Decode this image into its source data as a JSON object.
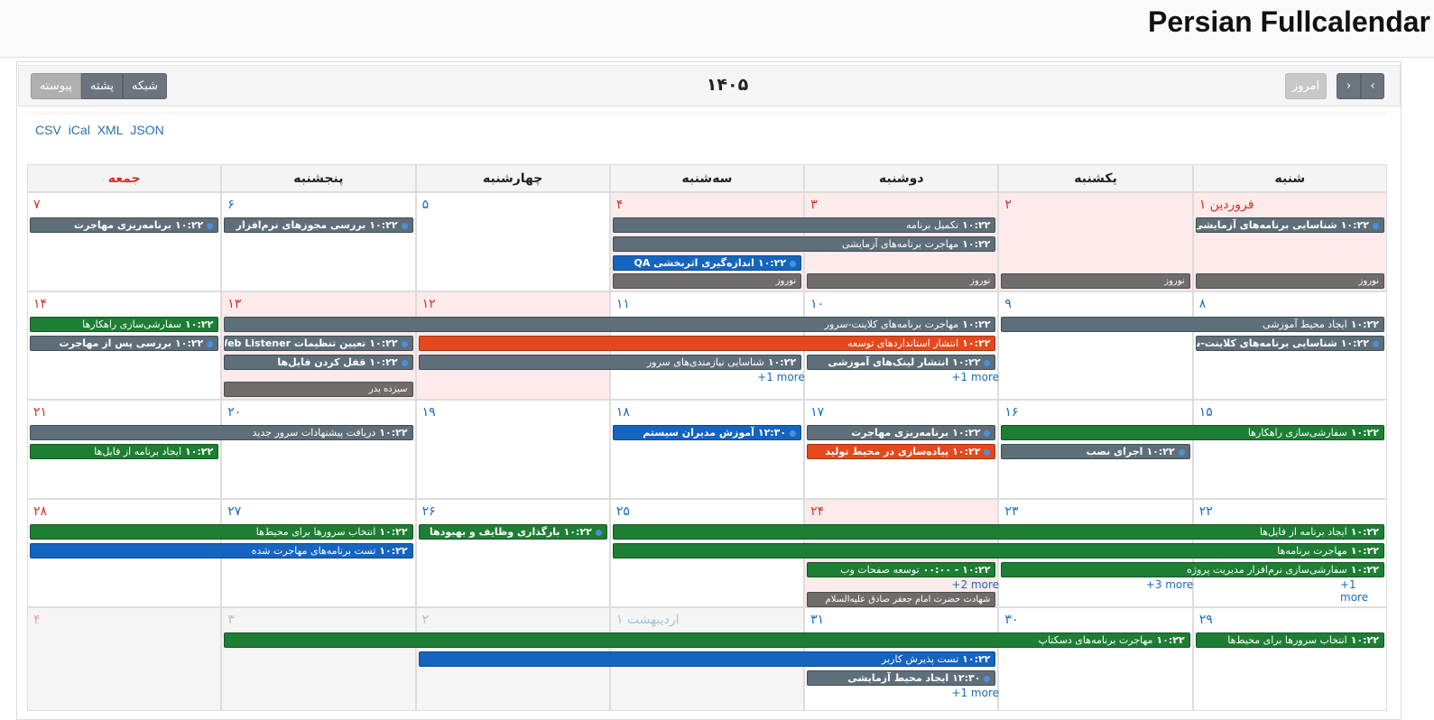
{
  "brand": "Persian Fullcalendar",
  "toolbar": {
    "prev": "‹",
    "next": "›",
    "today": "امروز",
    "title": "۱۴۰۵",
    "views": [
      "شبکه",
      "پشته",
      "پیوسته"
    ]
  },
  "exports": [
    "CSV",
    "iCal",
    "XML",
    "JSON"
  ],
  "weekdays": [
    "شنبه",
    "یکشنبه",
    "دوشنبه",
    "سه‌شنبه",
    "چهارشنبه",
    "پنجشنبه",
    "جمعه"
  ],
  "colors": {
    "gray": "#5f6f7a",
    "green": "#1e7e34",
    "blue": "#1565c0",
    "red": "#e4491c",
    "holiday": "#706c6c",
    "dayRed": "#d0322a",
    "dayBlue": "#1b6bb8"
  },
  "weeks": [
    {
      "days": [
        {
          "label": "فروردین ۱",
          "red": true,
          "hl": true
        },
        {
          "label": "۲",
          "red": true,
          "hl": true
        },
        {
          "label": "۳",
          "red": true,
          "hl": true
        },
        {
          "label": "۴",
          "red": true,
          "hl": true
        },
        {
          "label": "۵"
        },
        {
          "label": "۶"
        },
        {
          "label": "۷",
          "red": true
        }
      ],
      "events": [
        {
          "s": 0,
          "e": 0,
          "r": 0,
          "time": "۱۰:۲۲",
          "title": "شناسایی برنامه‌های آزمایشی",
          "color": "gray",
          "dot": true,
          "bold": true
        },
        {
          "s": 2,
          "e": 3,
          "r": 0,
          "time": "۱۰:۲۲",
          "title": "تکمیل برنامه",
          "color": "gray"
        },
        {
          "s": 2,
          "e": 3,
          "r": 1,
          "time": "۱۰:۲۲",
          "title": "مهاجرت برنامه‌های آزمایشی",
          "color": "gray"
        },
        {
          "s": 3,
          "e": 3,
          "r": 2,
          "time": "۱۰:۲۲",
          "title": "اندازه‌گیری اثربخشی QA",
          "color": "blue",
          "dot": true,
          "bold": true
        },
        {
          "s": 5,
          "e": 5,
          "r": 0,
          "time": "۱۰:۲۲",
          "title": "بررسی مجوزهای نرم‌افزار",
          "color": "gray",
          "dot": true,
          "bold": true
        },
        {
          "s": 6,
          "e": 6,
          "r": 0,
          "time": "۱۰:۲۲",
          "title": "برنامه‌ریزی مهاجرت",
          "color": "gray",
          "dot": true,
          "bold": true
        },
        {
          "s": 0,
          "e": 0,
          "r": 3,
          "time": "",
          "title": "نوروز",
          "color": "holi"
        },
        {
          "s": 1,
          "e": 1,
          "r": 3,
          "time": "",
          "title": "نوروز",
          "color": "holi"
        },
        {
          "s": 2,
          "e": 2,
          "r": 3,
          "time": "",
          "title": "نوروز",
          "color": "holi"
        },
        {
          "s": 3,
          "e": 3,
          "r": 3,
          "time": "",
          "title": "نوروز",
          "color": "holi"
        }
      ],
      "more": []
    },
    {
      "days": [
        {
          "label": "۸"
        },
        {
          "label": "۹"
        },
        {
          "label": "۱۰"
        },
        {
          "label": "۱۱"
        },
        {
          "label": "۱۲",
          "red": true,
          "hl": true
        },
        {
          "label": "۱۳",
          "red": true,
          "hl": true
        },
        {
          "label": "۱۴",
          "red": true
        }
      ],
      "events": [
        {
          "s": 0,
          "e": 1,
          "r": 0,
          "time": "۱۰:۲۲",
          "title": "ایجاد محیط آموزشی",
          "color": "gray"
        },
        {
          "s": 2,
          "e": 5,
          "r": 0,
          "time": "۱۰:۲۲",
          "title": "مهاجرت برنامه‌های کلاینت-سرور",
          "color": "gray"
        },
        {
          "s": 6,
          "e": 6,
          "r": 0,
          "time": "۱۰:۲۲",
          "title": "سفارشی‌سازی راهکارها",
          "color": "green"
        },
        {
          "s": 0,
          "e": 0,
          "r": 1,
          "time": "۱۰:۲۲",
          "title": "شناسایی برنامه‌های کلاینت-سرور",
          "color": "gray",
          "dot": true,
          "bold": true
        },
        {
          "s": 2,
          "e": 4,
          "r": 1,
          "time": "۱۰:۲۲",
          "title": "انتشار استانداردهای توسعه",
          "color": "red"
        },
        {
          "s": 5,
          "e": 5,
          "r": 1,
          "time": "۱۰:۲۲",
          "title": "تعیین تنظیمات Web Listener",
          "color": "gray",
          "dot": true,
          "bold": true
        },
        {
          "s": 6,
          "e": 6,
          "r": 1,
          "time": "۱۰:۲۲",
          "title": "بررسی پس از مهاجرت",
          "color": "gray",
          "dot": true,
          "bold": true
        },
        {
          "s": 2,
          "e": 2,
          "r": 2,
          "time": "۱۰:۲۲",
          "title": "انتشار لینک‌های آموزشی",
          "color": "gray",
          "dot": true,
          "bold": true
        },
        {
          "s": 3,
          "e": 4,
          "r": 2,
          "time": "۱۰:۲۲",
          "title": "شناسایی نیازمندی‌های سرور",
          "color": "gray"
        },
        {
          "s": 5,
          "e": 5,
          "r": 2,
          "time": "۱۰:۲۲",
          "title": "قفل کردن فایل‌ها",
          "color": "gray",
          "dot": true,
          "bold": true
        },
        {
          "s": 5,
          "e": 5,
          "r": 3,
          "time": "",
          "title": "سیزده بدر",
          "color": "holi"
        }
      ],
      "more": [
        {
          "col": 2,
          "text": "+1 more"
        },
        {
          "col": 3,
          "text": "+1 more"
        }
      ]
    },
    {
      "days": [
        {
          "label": "۱۵"
        },
        {
          "label": "۱۶"
        },
        {
          "label": "۱۷"
        },
        {
          "label": "۱۸"
        },
        {
          "label": "۱۹"
        },
        {
          "label": "۲۰"
        },
        {
          "label": "۲۱",
          "red": true
        }
      ],
      "events": [
        {
          "s": 0,
          "e": 1,
          "r": 0,
          "time": "۱۰:۲۲",
          "title": "سفارشی‌سازی راهکارها",
          "color": "green"
        },
        {
          "s": 2,
          "e": 2,
          "r": 0,
          "time": "۱۰:۲۲",
          "title": "برنامه‌ریزی مهاجرت",
          "color": "gray",
          "dot": true,
          "bold": true
        },
        {
          "s": 3,
          "e": 3,
          "r": 0,
          "time": "۱۲:۳۰",
          "title": "آموزش مدیران سیستم",
          "color": "blue",
          "dot": true,
          "bold": true
        },
        {
          "s": 5,
          "e": 6,
          "r": 0,
          "time": "۱۰:۲۲",
          "title": "دریافت پیشنهادات سرور جدید",
          "color": "gray"
        },
        {
          "s": 1,
          "e": 1,
          "r": 1,
          "time": "۱۰:۲۲",
          "title": "اجرای نصب",
          "color": "gray",
          "dot": true,
          "bold": true
        },
        {
          "s": 2,
          "e": 2,
          "r": 1,
          "time": "۱۰:۲۲",
          "title": "پیاده‌سازی در محیط تولید",
          "color": "red",
          "dot": true,
          "bold": true
        },
        {
          "s": 6,
          "e": 6,
          "r": 1,
          "time": "۱۰:۲۲",
          "title": "ایجاد برنامه از فایل‌ها",
          "color": "green"
        }
      ],
      "more": []
    },
    {
      "days": [
        {
          "label": "۲۲"
        },
        {
          "label": "۲۳"
        },
        {
          "label": "۲۴",
          "red": true,
          "hl": true
        },
        {
          "label": "۲۵"
        },
        {
          "label": "۲۶"
        },
        {
          "label": "۲۷"
        },
        {
          "label": "۲۸",
          "red": true
        }
      ],
      "events": [
        {
          "s": 0,
          "e": 3,
          "r": 0,
          "time": "۱۰:۲۲",
          "title": "ایجاد برنامه از فایل‌ها",
          "color": "green"
        },
        {
          "s": 4,
          "e": 4,
          "r": 0,
          "time": "۱۰:۲۲",
          "title": "بارگذاری وظایف و بهبودها",
          "color": "green",
          "dot": true,
          "bold": true
        },
        {
          "s": 5,
          "e": 6,
          "r": 0,
          "time": "۱۰:۲۲",
          "title": "انتخاب سرورها برای محیط‌ها",
          "color": "green"
        },
        {
          "s": 0,
          "e": 3,
          "r": 1,
          "time": "۱۰:۲۲",
          "title": "مهاجرت برنامه‌ها",
          "color": "green"
        },
        {
          "s": 5,
          "e": 6,
          "r": 1,
          "time": "۱۰:۲۲",
          "title": "تست برنامه‌های مهاجرت شده",
          "color": "blue"
        },
        {
          "s": 0,
          "e": 1,
          "r": 2,
          "time": "۱۰:۲۲",
          "title": "سفارشی‌سازی نرم‌افزار مدیریت پروژه",
          "color": "green"
        },
        {
          "s": 2,
          "e": 2,
          "r": 2,
          "time": "۱۰:۲۲ - ۰۰:۰۰",
          "title": "توسعه صفحات وب",
          "color": "green"
        },
        {
          "s": 2,
          "e": 2,
          "r": 4,
          "time": "",
          "title": "شهادت حضرت امام جعفر صادق علیه‌السلام",
          "color": "holi"
        }
      ],
      "more": [
        {
          "col": 0,
          "text": "+1 more"
        },
        {
          "col": 1,
          "text": "+3 more"
        },
        {
          "col": 2,
          "text": "+2 more"
        }
      ]
    },
    {
      "days": [
        {
          "label": "۲۹"
        },
        {
          "label": "۳۰"
        },
        {
          "label": "۳۱"
        },
        {
          "label": "اردیبهشت ۱",
          "out": true
        },
        {
          "label": "۲",
          "out": true
        },
        {
          "label": "۳",
          "out": true
        },
        {
          "label": "۴",
          "out": true,
          "red": true
        }
      ],
      "events": [
        {
          "s": 0,
          "e": 0,
          "r": 0,
          "time": "۱۰:۲۲",
          "title": "انتخاب سرورها برای محیط‌ها",
          "color": "green"
        },
        {
          "s": 1,
          "e": 5,
          "r": 0,
          "time": "۱۰:۲۲",
          "title": "مهاجرت برنامه‌های دسکتاپ",
          "color": "green"
        },
        {
          "s": 2,
          "e": 4,
          "r": 1,
          "time": "۱۰:۲۲",
          "title": "تست پذیرش کاربر",
          "color": "blue"
        },
        {
          "s": 2,
          "e": 2,
          "r": 2,
          "time": "۱۲:۳۰",
          "title": "ایجاد محیط آزمایشی",
          "color": "gray",
          "dot": true,
          "bold": true
        }
      ],
      "more": [
        {
          "col": 2,
          "text": "+1 more"
        }
      ]
    }
  ]
}
